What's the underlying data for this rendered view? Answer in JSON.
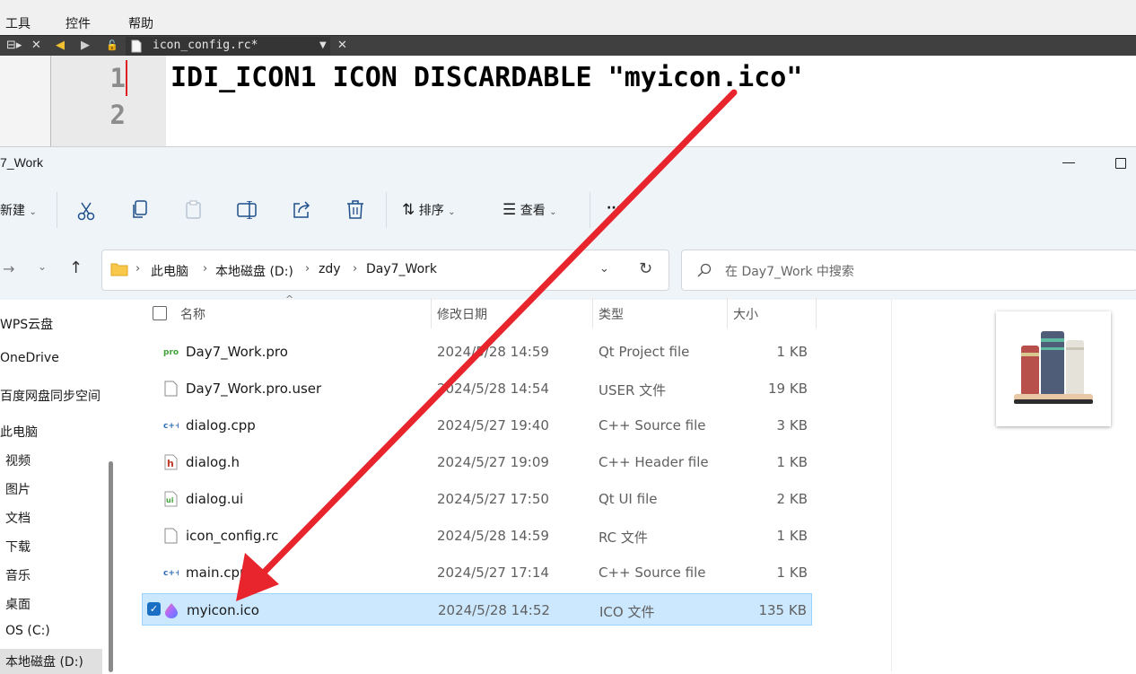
{
  "editor": {
    "menu": [
      "工具",
      "控件",
      "帮助"
    ],
    "tab_filename": "icon_config.rc*",
    "line_numbers": [
      "1",
      "2"
    ],
    "code_line_1": "IDI_ICON1 ICON DISCARDABLE \"myicon.ico\""
  },
  "explorer": {
    "window_title": "7_Work",
    "commands": {
      "new": "新建",
      "sort": "排序",
      "view": "查看",
      "more": "···"
    },
    "address": {
      "crumbs": [
        "此电脑",
        "本地磁盘 (D:)",
        "zdy",
        "Day7_Work"
      ]
    },
    "search": {
      "placeholder": "在 Day7_Work 中搜索"
    },
    "nav_items": [
      "WPS云盘",
      "OneDrive",
      "百度网盘同步空间",
      "此电脑",
      "视频",
      "图片",
      "文档",
      "下载",
      "音乐",
      "桌面",
      "OS (C:)",
      "本地磁盘 (D:)"
    ],
    "columns": {
      "name": "名称",
      "date": "修改日期",
      "type": "类型",
      "size": "大小"
    },
    "files": [
      {
        "name": "Day7_Work.pro",
        "date": "2024/5/28 14:59",
        "type": "Qt Project file",
        "size": "1 KB",
        "icon": "pro-file-icon"
      },
      {
        "name": "Day7_Work.pro.user",
        "date": "2024/5/28 14:54",
        "type": "USER 文件",
        "size": "19 KB",
        "icon": "blank-file-icon"
      },
      {
        "name": "dialog.cpp",
        "date": "2024/5/27 19:40",
        "type": "C++ Source file",
        "size": "3 KB",
        "icon": "cpp-file-icon"
      },
      {
        "name": "dialog.h",
        "date": "2024/5/27 19:09",
        "type": "C++ Header file",
        "size": "1 KB",
        "icon": "header-file-icon"
      },
      {
        "name": "dialog.ui",
        "date": "2024/5/27 17:50",
        "type": "Qt UI file",
        "size": "2 KB",
        "icon": "ui-file-icon"
      },
      {
        "name": "icon_config.rc",
        "date": "2024/5/28 14:59",
        "type": "RC 文件",
        "size": "1 KB",
        "icon": "blank-file-icon"
      },
      {
        "name": "main.cpp",
        "date": "2024/5/27 17:14",
        "type": "C++ Source file",
        "size": "1 KB",
        "icon": "cpp-file-icon"
      },
      {
        "name": "myicon.ico",
        "date": "2024/5/28 14:52",
        "type": "ICO 文件",
        "size": "135 KB",
        "icon": "ico-file-icon",
        "selected": true
      }
    ]
  },
  "colors": {
    "arrow": "#e8242c",
    "selection": "#cce8ff",
    "editor_tabbar": "#404040"
  }
}
